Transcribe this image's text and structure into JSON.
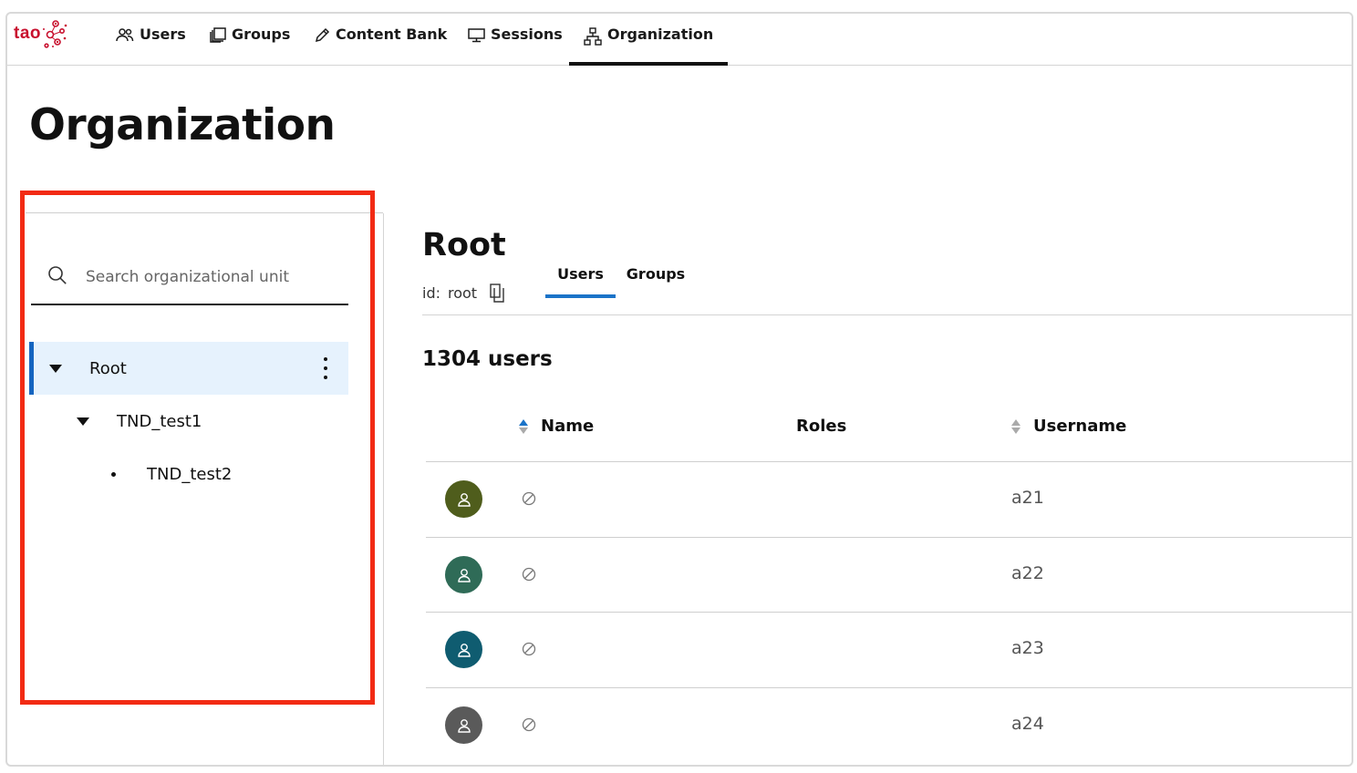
{
  "app": {
    "logo_text": "tao",
    "brand_color": "#c8102e"
  },
  "nav": {
    "items": [
      {
        "label": "Users",
        "icon": "users-icon"
      },
      {
        "label": "Groups",
        "icon": "groups-icon"
      },
      {
        "label": "Content Bank",
        "icon": "pencil-icon"
      },
      {
        "label": "Sessions",
        "icon": "monitor-icon"
      },
      {
        "label": "Organization",
        "icon": "org-chart-icon",
        "active": true
      }
    ]
  },
  "page": {
    "title": "Organization"
  },
  "tree": {
    "search_placeholder": "Search organizational unit",
    "nodes": [
      {
        "label": "Root",
        "selected": true,
        "expanded": true
      },
      {
        "label": "TND_test1",
        "expanded": true
      },
      {
        "label": "TND_test2"
      }
    ]
  },
  "detail": {
    "title": "Root",
    "id_label": "id:",
    "id_value": "root",
    "tabs": [
      {
        "label": "Users",
        "active": true
      },
      {
        "label": "Groups"
      }
    ],
    "user_count": "1304 users",
    "columns": {
      "name": "Name",
      "roles": "Roles",
      "username": "Username"
    },
    "rows": [
      {
        "username": "a21",
        "avatar_color": "#4f5d1c"
      },
      {
        "username": "a22",
        "avatar_color": "#2f6b57"
      },
      {
        "username": "a23",
        "avatar_color": "#0f5c70"
      },
      {
        "username": "a24",
        "avatar_color": "#5a5a5a"
      }
    ]
  },
  "colors": {
    "accent": "#1a73c8",
    "highlight": "#f22b14",
    "selected_bg": "#e6f2fd"
  }
}
